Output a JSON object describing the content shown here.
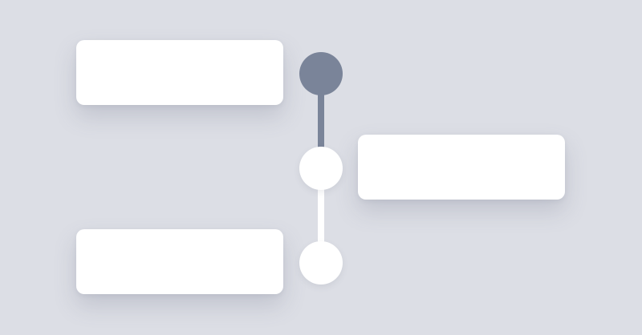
{
  "timeline": {
    "steps": [
      {
        "state": "active",
        "side": "left"
      },
      {
        "state": "inactive",
        "side": "right"
      },
      {
        "state": "inactive",
        "side": "left"
      }
    ],
    "progress": 0.5
  },
  "colors": {
    "background": "#dcdee5",
    "card": "#ffffff",
    "active": "#7a8499",
    "inactive": "#ffffff"
  }
}
